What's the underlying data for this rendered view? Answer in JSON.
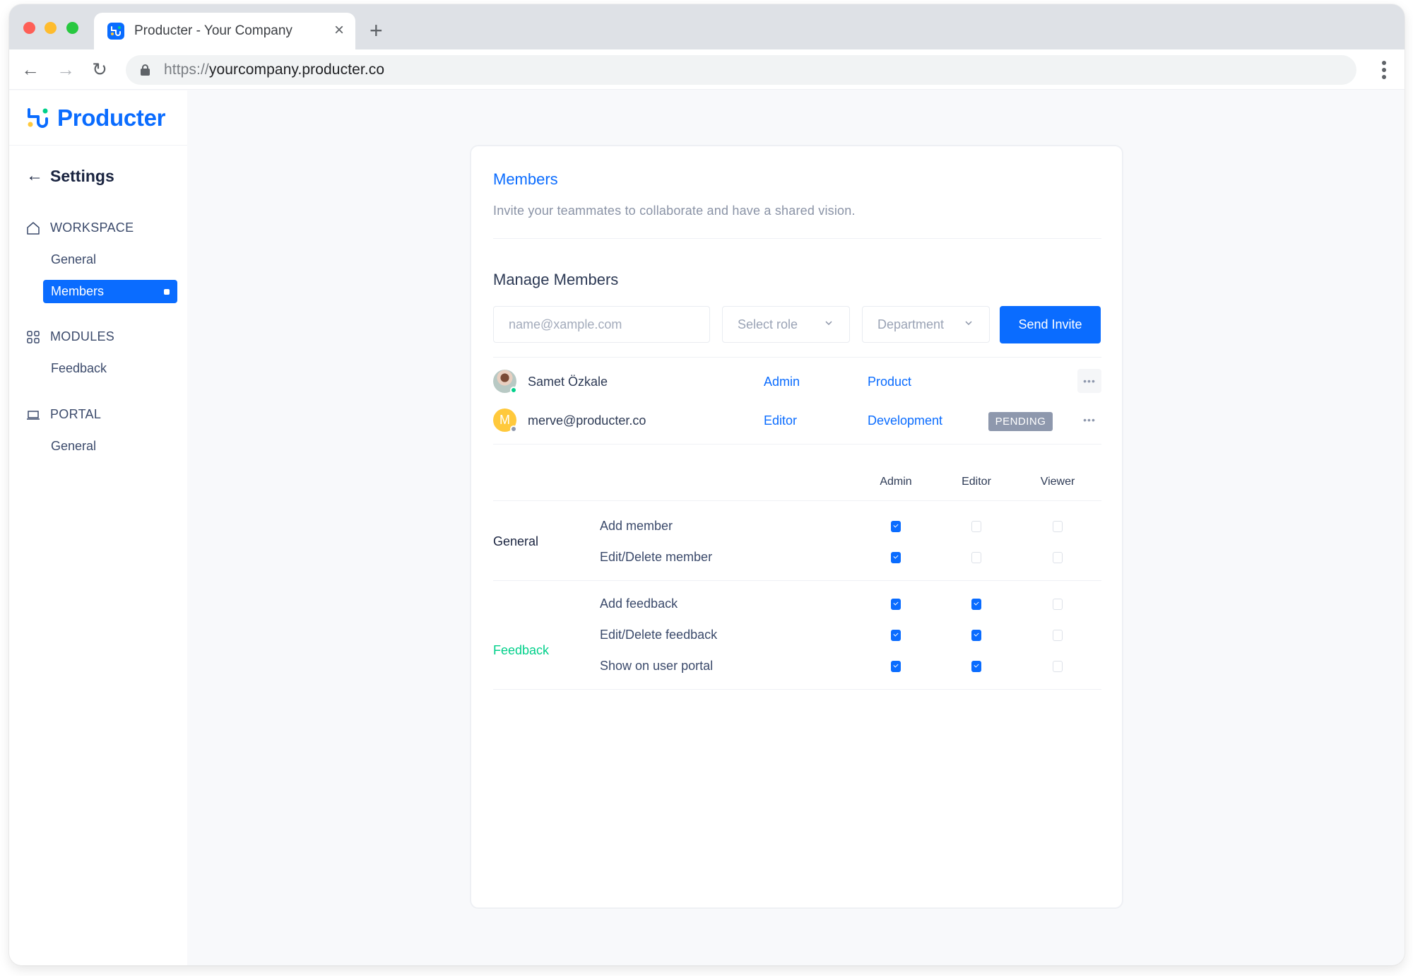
{
  "browser": {
    "tab_title": "Producter - Your Company",
    "url_scheme": "https://",
    "url_host": "yourcompany.producter.co",
    "icons": {
      "close": "×",
      "new_tab": "+",
      "back": "←",
      "forward": "→",
      "reload": "↻"
    }
  },
  "sidebar": {
    "logo_text": "Producter",
    "back_label": "Settings",
    "sections": [
      {
        "label": "WORKSPACE",
        "icon": "home-icon",
        "items": [
          {
            "label": "General",
            "active": false
          },
          {
            "label": "Members",
            "active": true
          }
        ]
      },
      {
        "label": "MODULES",
        "icon": "grid-icon",
        "items": [
          {
            "label": "Feedback",
            "active": false
          }
        ]
      },
      {
        "label": "PORTAL",
        "icon": "laptop-icon",
        "items": [
          {
            "label": "General",
            "active": false
          }
        ]
      }
    ]
  },
  "card": {
    "title": "Members",
    "subtitle": "Invite your teammates to collaborate and have a shared vision.",
    "manage_title": "Manage Members",
    "invite": {
      "email_placeholder": "name@xample.com",
      "email_value": "",
      "role_placeholder": "Select role",
      "department_placeholder": "Department",
      "send_label": "Send Invite"
    },
    "members": [
      {
        "name": "Samet Özkale",
        "role": "Admin",
        "department": "Product",
        "status": "",
        "presence": "online",
        "avatar": "photo"
      },
      {
        "name": "merve@producter.co",
        "role": "Editor",
        "department": "Development",
        "status": "PENDING",
        "presence": "offline",
        "avatar_initial": "M"
      }
    ],
    "permissions": {
      "columns": [
        "Admin",
        "Editor",
        "Viewer"
      ],
      "groups": [
        {
          "label": "General",
          "color": "#1a2440",
          "rows": [
            {
              "label": "Add member",
              "values": [
                true,
                false,
                false
              ]
            },
            {
              "label": "Edit/Delete member",
              "values": [
                true,
                false,
                false
              ]
            }
          ]
        },
        {
          "label": "Feedback",
          "color": "#00d08a",
          "rows": [
            {
              "label": "Add feedback",
              "values": [
                true,
                true,
                false
              ]
            },
            {
              "label": "Edit/Delete feedback",
              "values": [
                true,
                true,
                false
              ]
            },
            {
              "label": "Show on user portal",
              "values": [
                true,
                true,
                false
              ]
            }
          ]
        }
      ]
    }
  },
  "colors": {
    "accent": "#0a6cff",
    "feedback_green": "#00d08a",
    "pending_badge": "#8e98ad",
    "online": "#00d08a",
    "offline": "#8e98ad"
  }
}
